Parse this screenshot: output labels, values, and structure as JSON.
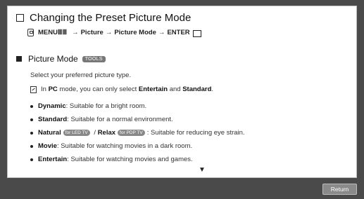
{
  "header": {
    "title": "Changing the Preset Picture Mode",
    "path": {
      "menu_label": "MENU",
      "menu_icon": "ⅢⅢ",
      "step1": "Picture",
      "step2": "Picture Mode",
      "step3": "ENTER",
      "arrow": "→"
    }
  },
  "section": {
    "title": "Picture Mode",
    "tools_badge": "TOOLS",
    "description": "Select your preferred picture type.",
    "note": {
      "text_before": "In ",
      "pc": "PC",
      "text_mid": " mode, you can only select ",
      "entertain": "Entertain",
      "and": " and ",
      "standard": "Standard",
      "end": "."
    },
    "items": [
      {
        "name": "Dynamic",
        "desc": ": Suitable for a bright room."
      },
      {
        "name": "Standard",
        "desc": ": Suitable for a normal environment."
      },
      {
        "name": "Natural",
        "pill1": "for LED TV",
        "sep": " / ",
        "name2": "Relax",
        "pill2": "for PDP TV",
        "desc": ": Suitable for reducing eye strain."
      },
      {
        "name": "Movie",
        "desc": ": Suitable for watching movies in a dark room."
      },
      {
        "name": "Entertain",
        "desc": ": Suitable for watching movies and games."
      }
    ]
  },
  "scroll_indicator": "▼",
  "footer": {
    "return_label": "Return"
  }
}
